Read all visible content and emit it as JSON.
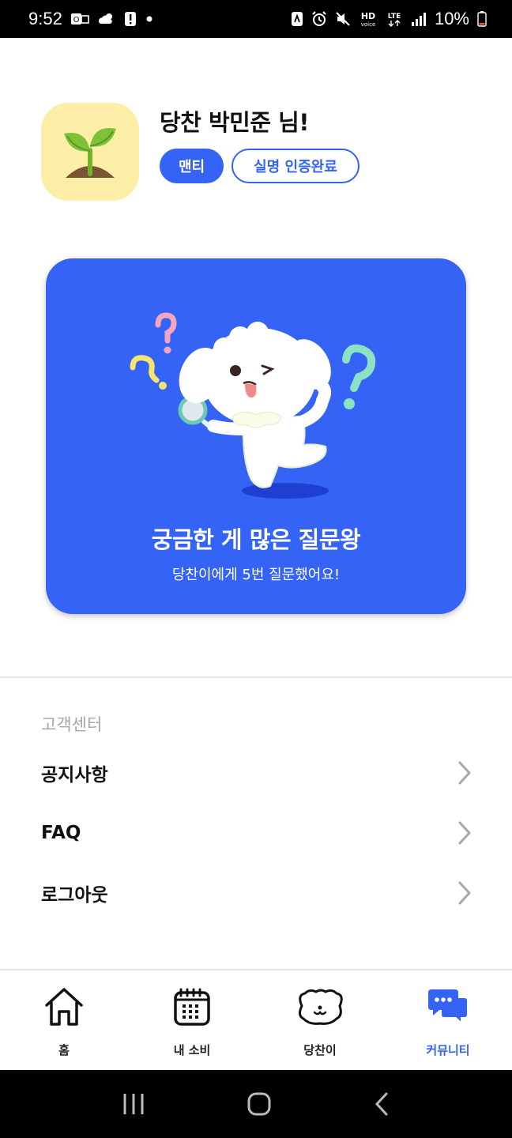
{
  "status_bar": {
    "time": "9:52",
    "battery": "10%",
    "left_icons": [
      "outlook-icon",
      "cloudy-weather-icon",
      "alert-icon",
      "dot-icon"
    ],
    "right_icons": [
      "nfc-icon",
      "alarm-icon",
      "mute-icon",
      "hd-voice-icon",
      "lte-icon",
      "signal-icon",
      "battery-icon"
    ],
    "hd_label": "HD",
    "voice_label": "voice",
    "lte_label": "LTE"
  },
  "profile": {
    "name": "당찬 박민준 님!",
    "avatar_icon": "sprout-icon",
    "role_badge": "맨티",
    "verified_badge": "실명 인증완료"
  },
  "achievement_card": {
    "title": "궁금한 게 많은 질문왕",
    "subtitle": "당찬이에게 5번 질문했어요!",
    "illustration": "puppy-with-magnifier-and-question-marks"
  },
  "customer_center": {
    "section_title": "고객센터",
    "items": [
      {
        "label": "공지사항",
        "icon": "chevron-right-icon"
      },
      {
        "label": "FAQ",
        "icon": "chevron-right-icon"
      },
      {
        "label": "로그아웃",
        "icon": "chevron-right-icon"
      }
    ]
  },
  "bottom_nav": {
    "active": "커뮤니티",
    "accent_color": "#3563f5",
    "items": [
      {
        "label": "홈",
        "icon": "home-icon"
      },
      {
        "label": "내 소비",
        "icon": "calendar-icon"
      },
      {
        "label": "당찬이",
        "icon": "puppy-face-icon"
      },
      {
        "label": "커뮤니티",
        "icon": "chat-bubbles-icon"
      }
    ]
  },
  "system_nav": [
    "recent-apps-icon",
    "home-button-icon",
    "back-icon"
  ],
  "colors": {
    "primary": "#3563f5",
    "avatar_bg": "#fdeea7",
    "muted_text": "#a6a6a6"
  }
}
